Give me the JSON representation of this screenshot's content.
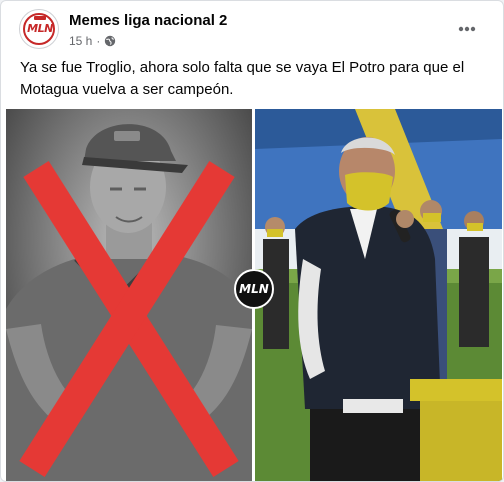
{
  "post": {
    "page_name": "Memes liga nacional 2",
    "time": "15 h",
    "separator": "·",
    "text_line1": "Ya se fue Troglio, ahora solo falta que se vaya El Potro para que el",
    "text_line2": "Motagua vuelva a ser campeón."
  },
  "avatar": {
    "logo_text": "MLN"
  },
  "media": {
    "badge_text": "MLN",
    "left_image": "troglio-crossed-out-photo",
    "right_image": "el-potro-speaking-photo"
  },
  "icons": {
    "globe": "globe-icon",
    "more": "more-icon"
  },
  "colors": {
    "cross": "#e53935",
    "mask": "#d4c22a",
    "accent": "#c62828"
  }
}
